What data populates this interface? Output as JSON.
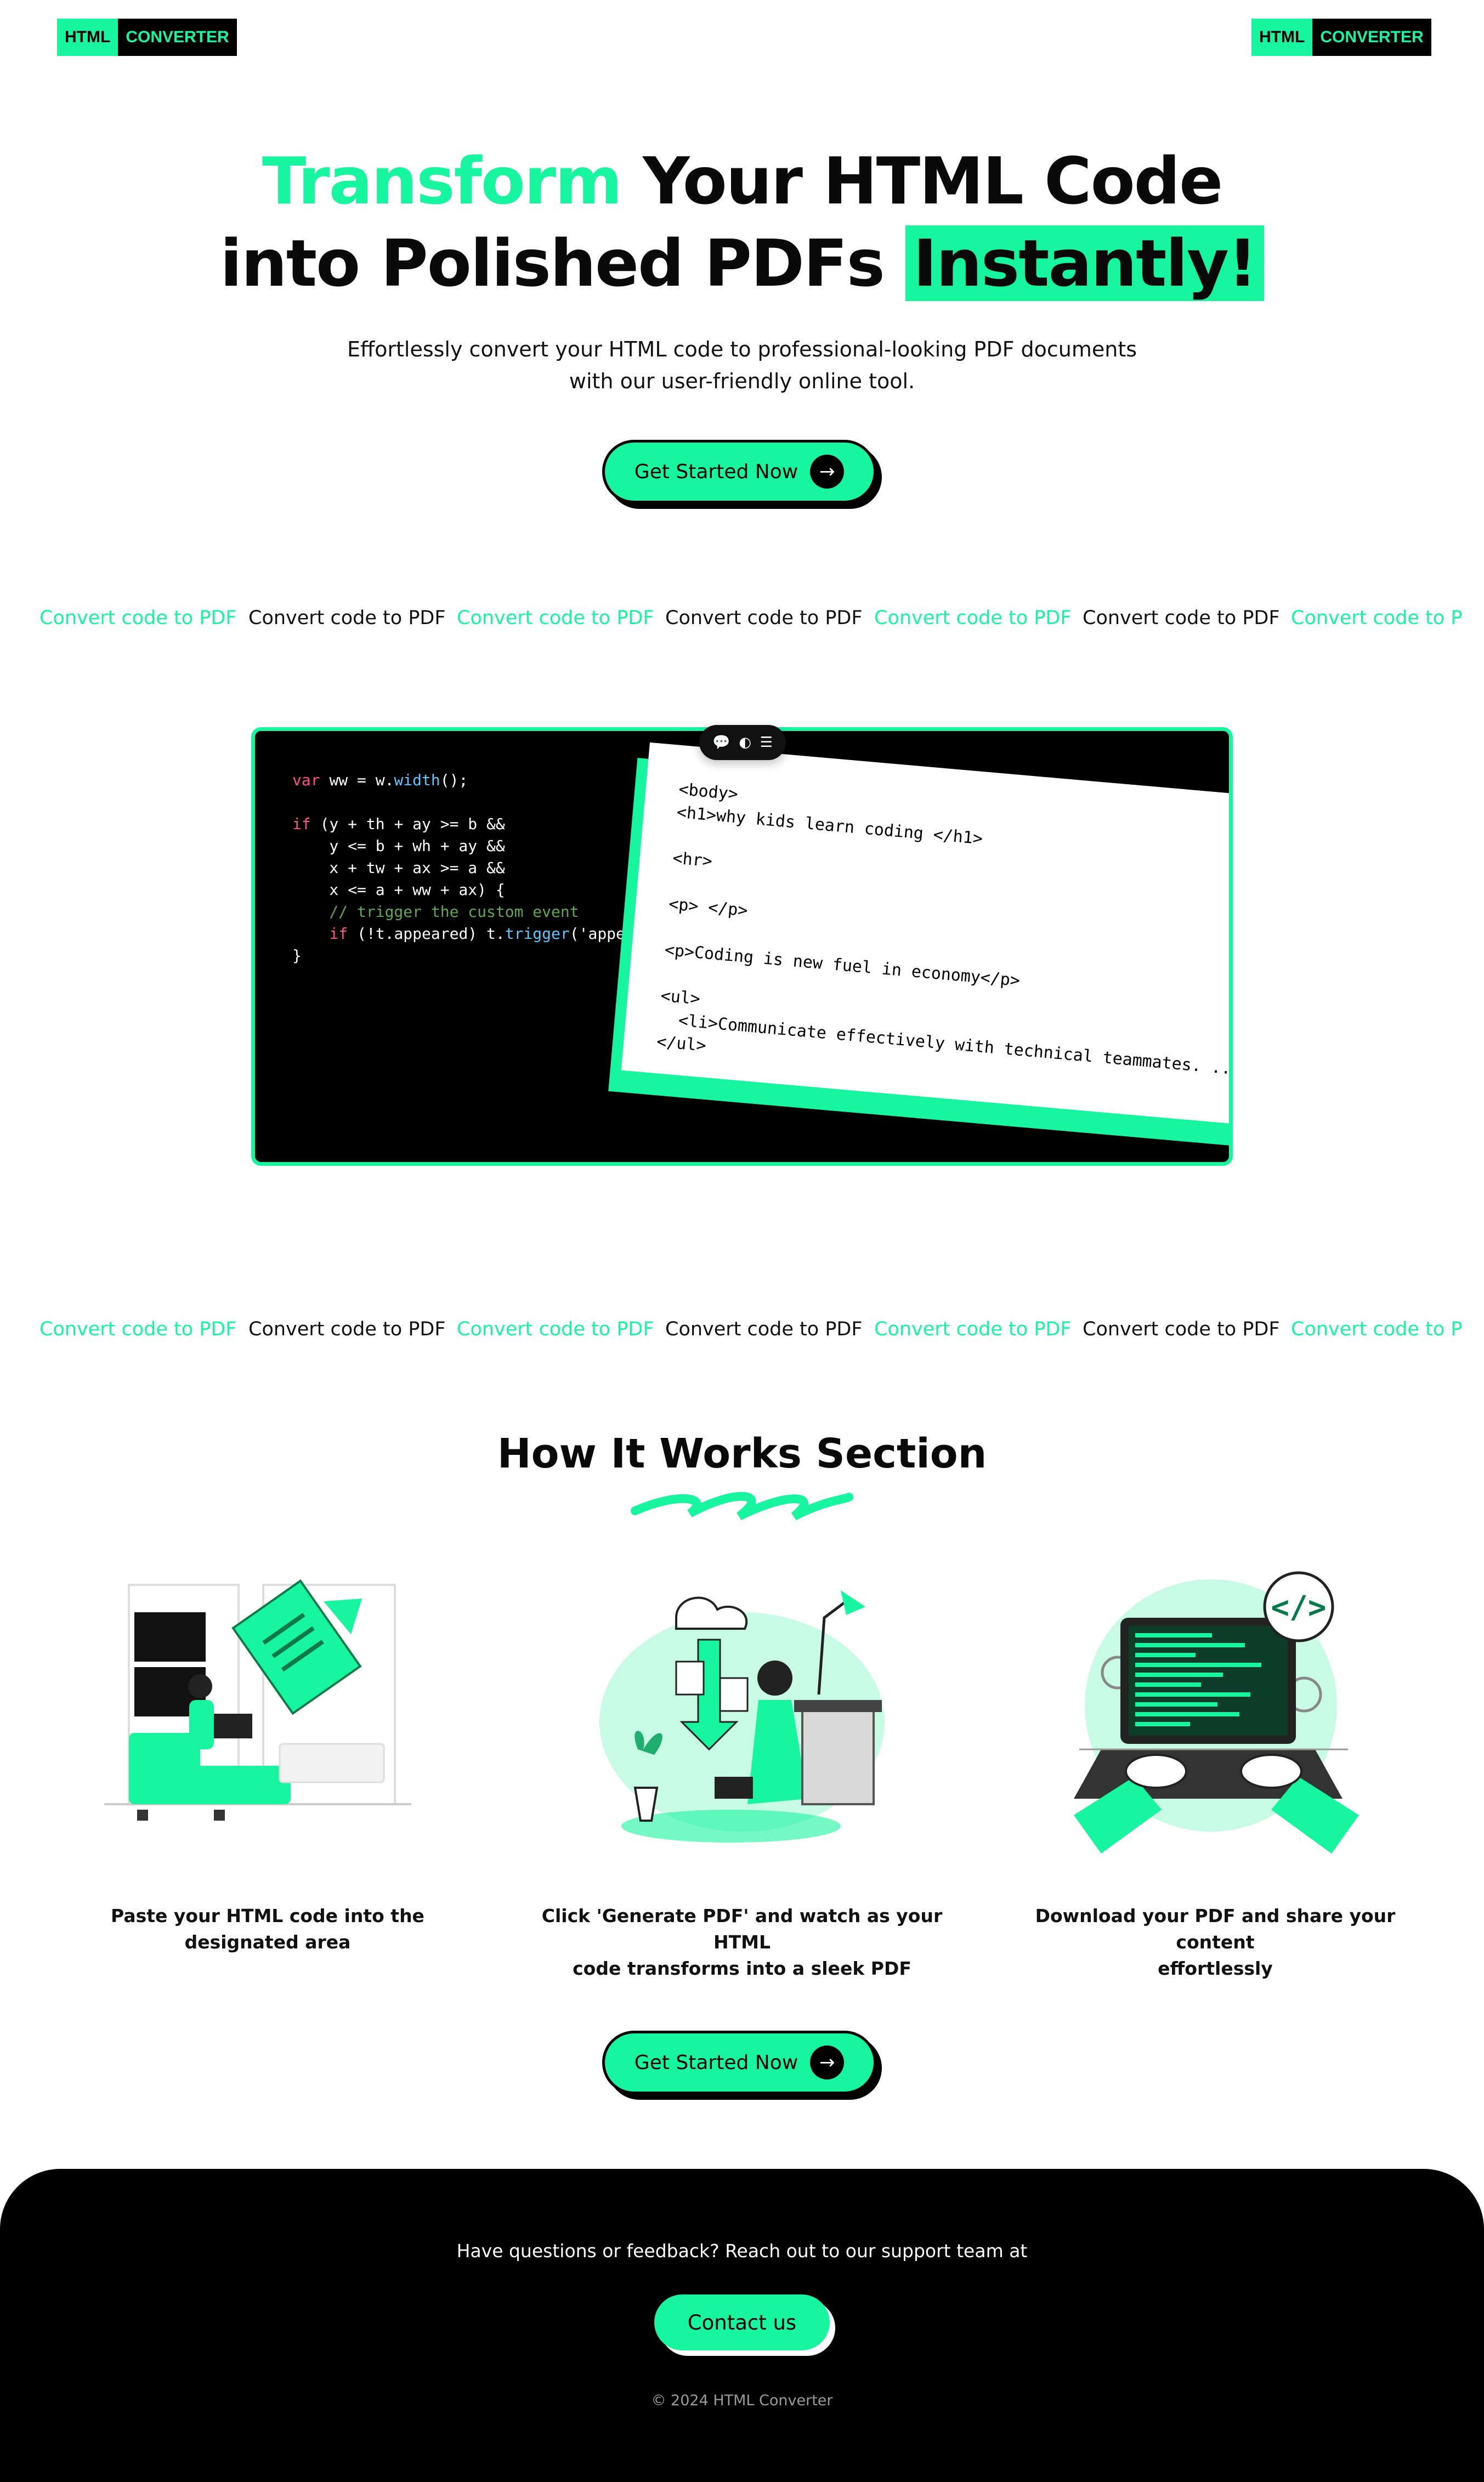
{
  "brand": {
    "part1": "HTML",
    "part2": "CONVERTER"
  },
  "hero": {
    "title_green": "Transform",
    "title_rest_line1": " Your HTML Code",
    "title_line2": "into Polished PDFs ",
    "title_highlight": "Instantly!",
    "subtitle_line1": "Effortlessly convert your HTML code to professional-looking PDF documents",
    "subtitle_line2": "with our user-friendly online tool.",
    "cta_label": "Get Started Now"
  },
  "marquee": {
    "items": [
      "Convert code to PDF",
      "Convert code to PDF",
      "Convert code to PDF",
      "Convert code to PDF",
      "Convert code to PDF",
      "Convert code to PDF",
      "Convert code to P"
    ]
  },
  "editor": {
    "code_lines": [
      "var ww = w.width();",
      "",
      "if (y + th + ay >= b &&",
      "    y <= b + wh + ay &&",
      "    x + tw + ax >= a &&",
      "    x <= a + ww + ax) {",
      "    // trigger the custom event",
      "    if (!t.appeared) t.trigger('appear'"
    ],
    "paper_lines": [
      "<body>",
      "<h1>why kids learn coding </h1>",
      "",
      "<hr>",
      "",
      "<p> </p>",
      "",
      "<p>Coding is new fuel in economy</p>",
      "",
      "<ul>",
      "  <li>Communicate effectively with technical teammates. ..</li>",
      "</ul>"
    ],
    "toolbar_icons": [
      "comment-icon",
      "toggle-icon",
      "settings-sliders-icon"
    ]
  },
  "how": {
    "title": "How It Works Section",
    "steps": [
      {
        "text_line1": "Paste your HTML code into the designated area",
        "text_line2": ""
      },
      {
        "text_line1": "Click 'Generate PDF' and watch as your HTML",
        "text_line2": "code transforms into a sleek PDF"
      },
      {
        "text_line1": "Download your PDF and share your content",
        "text_line2": "effortlessly"
      }
    ],
    "cta_label": "Get Started Now"
  },
  "footer": {
    "text": "Have questions or feedback? Reach out to our support team at",
    "contact_label": "Contact us",
    "copyright": "© 2024 HTML Converter"
  },
  "colors": {
    "accent": "#17f59f",
    "dark": "#000000",
    "white": "#ffffff"
  }
}
